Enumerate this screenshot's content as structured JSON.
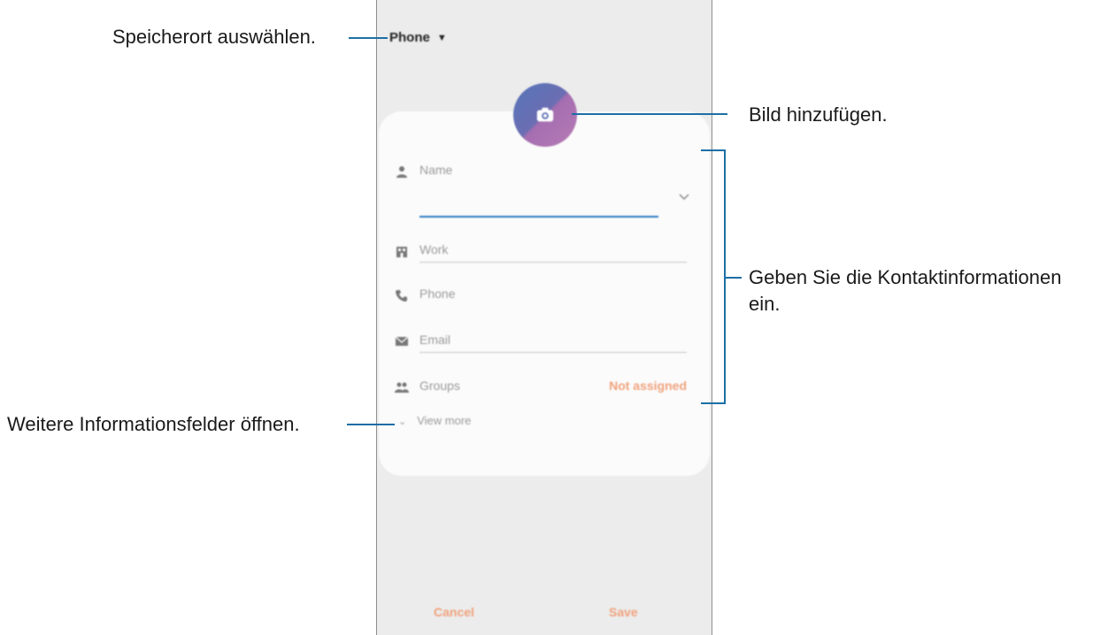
{
  "annotations": {
    "storage": "Speicherort auswählen.",
    "picture": "Bild hinzufügen.",
    "contact_info_line1": "Geben Sie die Kontaktinformationen",
    "contact_info_line2": "ein.",
    "more_fields": "Weitere Informationsfelder öffnen."
  },
  "screen": {
    "storage_label": "Phone",
    "fields": {
      "name": "Name",
      "work": "Work",
      "phone": "Phone",
      "email": "Email",
      "groups": "Groups",
      "groups_value": "Not assigned"
    },
    "view_more": "View more",
    "cancel": "Cancel",
    "save": "Save"
  },
  "colors": {
    "accent_line": "#1d6fa5",
    "name_underline": "#2e7cc4",
    "action_orange": "#f0a27d"
  },
  "icons": [
    "camera-icon",
    "person-icon",
    "building-icon",
    "phone-icon",
    "mail-icon",
    "group-icon",
    "chevron-down-icon"
  ]
}
